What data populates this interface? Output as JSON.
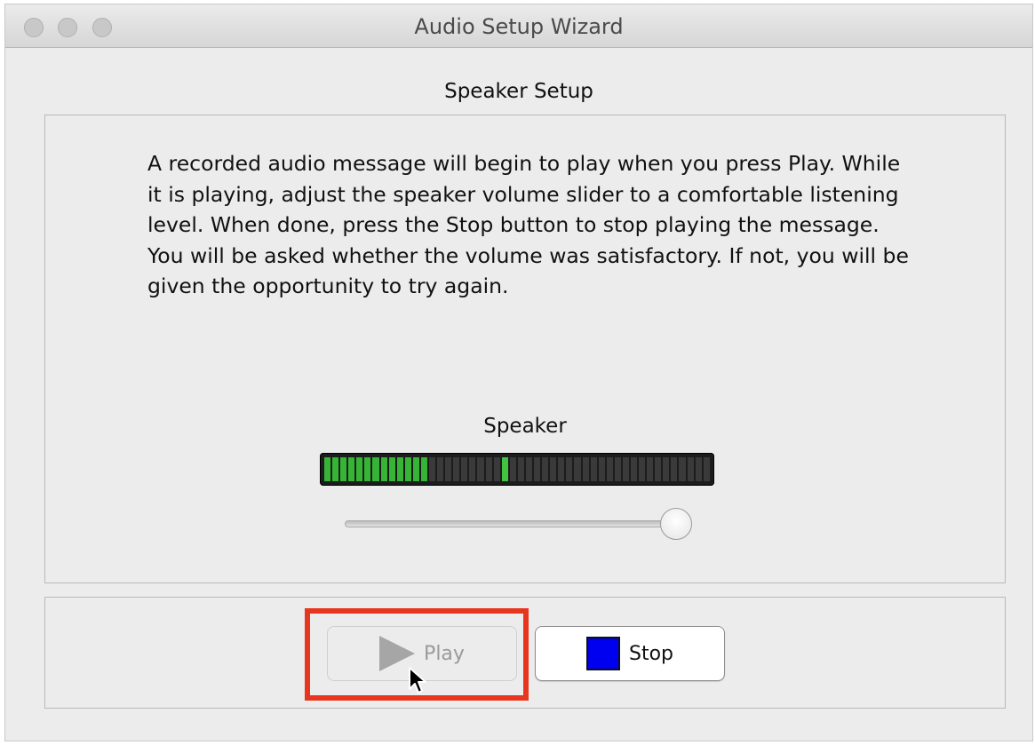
{
  "window": {
    "title": "Audio Setup Wizard"
  },
  "section_title": "Speaker Setup",
  "instructions": "A recorded audio message will begin to play when you press Play. While it is playing, adjust the speaker volume slider to a comfortable listening level. When done, press the Stop button to stop playing the message. You will be asked whether the volume was satisfactory. If not, you will be given the opportunity to try again.",
  "speaker": {
    "label": "Speaker",
    "meter": {
      "segments": 48,
      "lit_segments": 13,
      "peak_segment": 22
    },
    "volume_fraction": 0.97
  },
  "buttons": {
    "play_label": "Play",
    "play_enabled": false,
    "stop_label": "Stop"
  },
  "colors": {
    "highlight": "#e8351e",
    "meter_on": "#36b436",
    "stop_square": "#0000f0"
  },
  "icons": [
    "play-icon",
    "stop-icon",
    "mouse-cursor-icon"
  ]
}
